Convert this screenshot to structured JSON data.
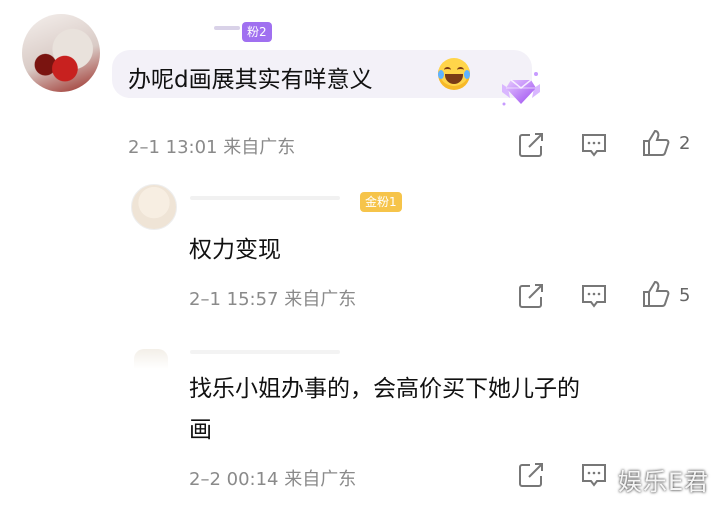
{
  "comments": [
    {
      "badge": "粉2",
      "text": "办呢d画展其实有咩意义",
      "meta": "2–1 13:01 来自广东",
      "likes": "2"
    },
    {
      "badge": "金粉1",
      "text": "权力变现",
      "meta": "2–1 15:57 来自广东",
      "likes": "5"
    },
    {
      "text_line1": "找乐小姐办事的，会高价买下她儿子的",
      "text_line2": "画",
      "meta": "2–2 00:14 来自广东"
    }
  ],
  "watermark": "娱乐E君",
  "colors": {
    "meta": "#8a8a8a",
    "badge_purple": "#a070f0",
    "badge_gold": "#f6c44a"
  },
  "icons": [
    "share-icon",
    "comment-icon",
    "like-icon",
    "gem-badge-icon",
    "laughing-emoji-icon"
  ]
}
